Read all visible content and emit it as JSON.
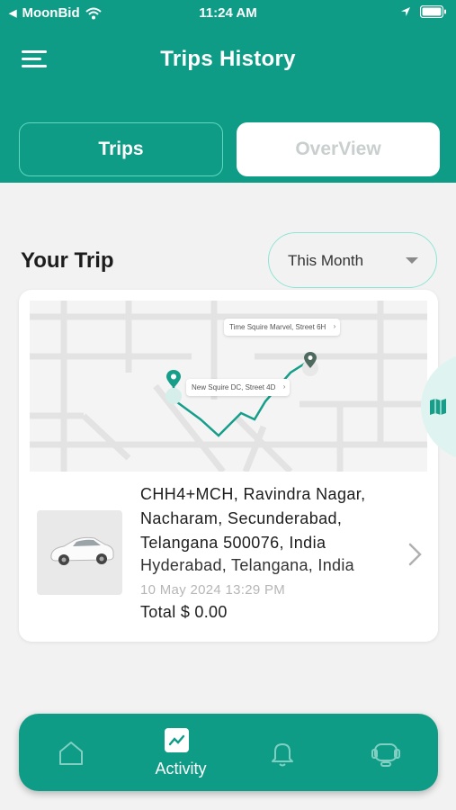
{
  "status_bar": {
    "carrier": "MoonBid",
    "time": "11:24 AM"
  },
  "header": {
    "title": "Trips History",
    "tabs": [
      {
        "label": "Trips",
        "active": true
      },
      {
        "label": "OverView",
        "active": false
      }
    ]
  },
  "section": {
    "title": "Your Trip",
    "filter": {
      "selected": "This Month"
    }
  },
  "trip": {
    "map": {
      "destination_label": "Time Squire Marvel, Street 6H",
      "origin_label": "New Squire DC, Street 4D"
    },
    "address_lines": [
      "CHH4+MCH, Ravindra Nagar,",
      "Nacharam, Secunderabad,",
      "Telangana 500076, India"
    ],
    "city": "Hyderabad, Telangana, India",
    "date": "10 May 2024  13:29 PM",
    "total": "Total $ 0.00"
  },
  "bottom_nav": {
    "items": [
      {
        "icon": "home-icon",
        "label": ""
      },
      {
        "icon": "activity-icon",
        "label": "Activity",
        "active": true
      },
      {
        "icon": "bell-icon",
        "label": ""
      },
      {
        "icon": "support-icon",
        "label": ""
      }
    ]
  },
  "colors": {
    "primary": "#0f9c86",
    "accent_light": "#8fe5d6",
    "background": "#f2f2f2"
  }
}
